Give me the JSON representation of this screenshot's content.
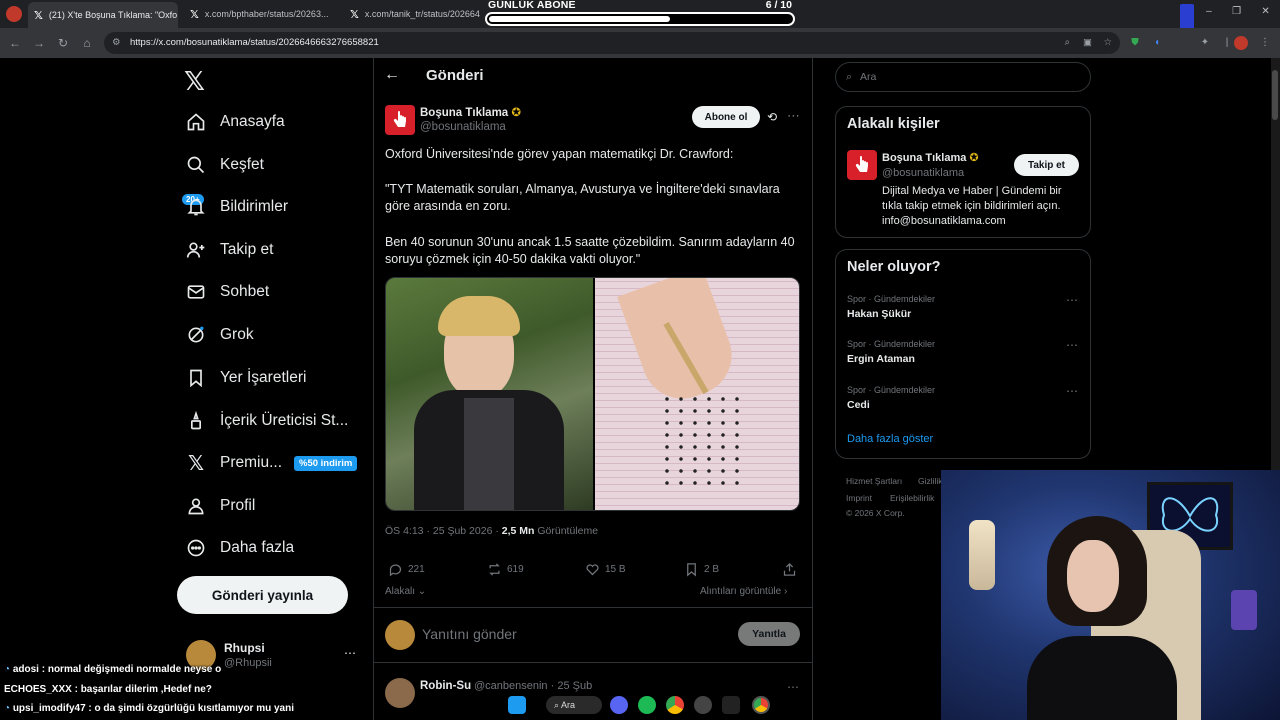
{
  "browser": {
    "tabs": [
      {
        "title": "(21) X'te Boşuna Tıklama: \"Oxfo",
        "active": true
      },
      {
        "title": "x.com/bpthaber/status/20263...",
        "active": false
      },
      {
        "title": "x.com/tanik_tr/status/2026648...",
        "active": false
      }
    ],
    "url": "https://x.com/bosunatiklama/status/2026646663276658821"
  },
  "sub_widget": {
    "title": "GÜNLÜK ABONE",
    "count_text": "6   / 10",
    "progress_fraction": 0.6
  },
  "nav": {
    "items": [
      {
        "label": "Anasayfa",
        "icon": "home-icon"
      },
      {
        "label": "Keşfet",
        "icon": "search-icon"
      },
      {
        "label": "Bildirimler",
        "icon": "bell-icon"
      },
      {
        "label": "Takip et",
        "icon": "follow-icon"
      },
      {
        "label": "Sohbet",
        "icon": "mail-icon"
      },
      {
        "label": "Grok",
        "icon": "grok-icon"
      },
      {
        "label": "Yer İşaretleri",
        "icon": "bookmark-icon"
      },
      {
        "label": "İçerik Üreticisi St...",
        "icon": "creator-icon"
      },
      {
        "label": "Premiu...",
        "icon": "x-premium-icon"
      },
      {
        "label": "Profil",
        "icon": "profile-icon"
      },
      {
        "label": "Daha fazla",
        "icon": "more-icon"
      }
    ],
    "notif_badge": "20+",
    "premium_badge": "%50 indirim",
    "post_button": "Gönderi yayınla",
    "account_name": "Rhupsi",
    "account_handle": "@Rhupsii"
  },
  "post": {
    "header_title": "Gönderi",
    "author_name": "Boşuna Tıklama",
    "author_handle": "@bosunatiklama",
    "follow_label": "Abone ol",
    "text_1": "Oxford Üniversitesi'nde görev yapan matematikçi Dr. Crawford:",
    "text_2": "\"TYT Matematik soruları, Almanya, Avusturya ve İngiltere'deki sınavlara göre arasında en zoru.",
    "text_3": "Ben 40 sorunun 30'unu ancak 1.5 saatte çözebildim. Sanırım adayların 40 soruyu çözmek için 40-50 dakika vakti oluyor.\"",
    "time": "ÖS 4:13 · 25 Şub 2026 · ",
    "views": "2,5 Mn",
    "views_label": " Görüntüleme",
    "replies": "221",
    "reposts": "619",
    "likes": "15 B",
    "bookmarks": "2 B",
    "relevant": "Alakalı",
    "quotes_link": "Alıntıları görüntüle",
    "reply_placeholder": "Yanıtını gönder",
    "reply_button": "Yanıtla",
    "next_reply_name": "Robin-Su",
    "next_reply_meta": "@canbensenin · 25 Şub"
  },
  "sidebar": {
    "search_placeholder": "Ara",
    "related_title": "Alakalı kişiler",
    "related_name": "Boşuna Tıklama",
    "related_handle": "@bosunatiklama",
    "related_bio": "Dijital Medya ve Haber | Gündemi bir tıkla takip etmek için bildirimleri açın. info@bosunatiklama.com",
    "related_button": "Takip et",
    "trends_title": "Neler oluyor?",
    "trends": [
      {
        "category": "Spor · Gündemdekiler",
        "name": "Hakan Şükür"
      },
      {
        "category": "Spor · Gündemdekiler",
        "name": "Ergin Ataman"
      },
      {
        "category": "Spor · Gündemdekiler",
        "name": "Cedi"
      }
    ],
    "show_more": "Daha fazla göster",
    "footer": {
      "terms": "Hizmet Şartları",
      "privacy": "Gizlilik",
      "imprint": "Imprint",
      "accessibility": "Erişilebilirlik",
      "copyright": "© 2026 X Corp."
    }
  },
  "chat": [
    {
      "user": "adosi",
      "message": "normal değişmedi normalde neyse o"
    },
    {
      "user": "ECHOES_XXX",
      "message": "başarılar dilerim ,Hedef ne?"
    },
    {
      "user": "upsi_imodify47",
      "message": "o da şimdi özgürlüğü kısıtlamıyor mu yani"
    }
  ],
  "taskbar": {
    "search_label": "Ara"
  },
  "colors": {
    "accent": "#1d9bf0",
    "brand_red": "#d8202a",
    "verified_gold": "#e2b719"
  }
}
